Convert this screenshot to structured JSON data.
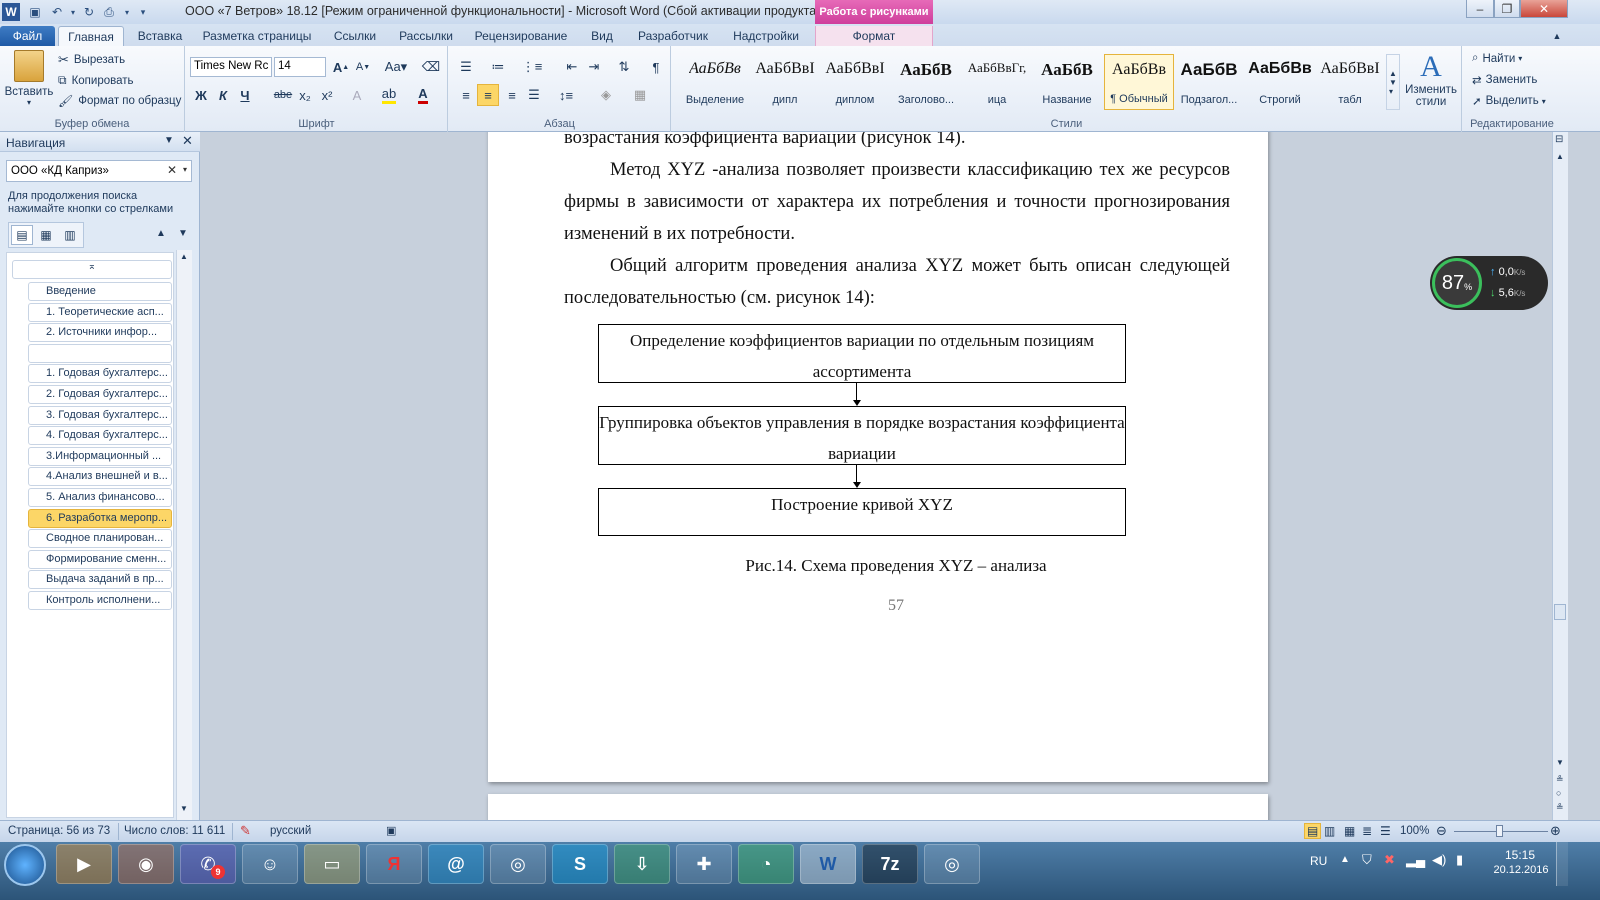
{
  "window": {
    "title": "ООО «7 Ветров»  18.12 [Режим ограниченной функциональности]  -  Microsoft Word (Сбой активации продукта)",
    "context_tab_header": "Работа с рисунками"
  },
  "ribbon_tabs": [
    "Файл",
    "Главная",
    "Вставка",
    "Разметка страницы",
    "Ссылки",
    "Рассылки",
    "Рецензирование",
    "Вид",
    "Разработчик",
    "Надстройки",
    "Формат"
  ],
  "clipboard": {
    "paste": "Вставить",
    "cut": "Вырезать",
    "copy": "Копировать",
    "format_painter": "Формат по образцу",
    "group": "Буфер обмена"
  },
  "font": {
    "name": "Times New Rc",
    "size": "14",
    "bold": "Ж",
    "italic": "К",
    "underline": "Ч",
    "strike": "abe",
    "sub": "x₂",
    "sup": "x²",
    "group": "Шрифт"
  },
  "paragraph": {
    "group": "Абзац"
  },
  "styles": {
    "items": [
      {
        "preview": "АаБбВв",
        "name": "Выделение"
      },
      {
        "preview": "АаБбВвІ",
        "name": "дипл"
      },
      {
        "preview": "АаБбВвІ",
        "name": "диплом"
      },
      {
        "preview": "АаБбВ",
        "name": "Заголово..."
      },
      {
        "preview": "АаБбВвГг,",
        "name": "ица"
      },
      {
        "preview": "АаБбВ",
        "name": "Название"
      },
      {
        "preview": "АаБбВв",
        "name": "¶ Обычный"
      },
      {
        "preview": "АаБбВ",
        "name": "Подзагол..."
      },
      {
        "preview": "АаБбВв",
        "name": "Строгий"
      },
      {
        "preview": "АаБбВвІ",
        "name": "табл"
      }
    ],
    "change_styles": "Изменить стили",
    "group": "Стили"
  },
  "editing": {
    "find": "Найти",
    "replace": "Заменить",
    "select": "Выделить",
    "group": "Редактирование"
  },
  "navigation": {
    "title": "Навигация",
    "search_value": "ООО «КД Каприз»",
    "hint": "Для продолжения поиска нажимайте кнопки со стрелками",
    "items": [
      {
        "label": "Введение",
        "selected": false
      },
      {
        "label": "1. Теоретические асп...",
        "selected": false
      },
      {
        "label": "2. Источники инфор...",
        "selected": false
      },
      {
        "label": "",
        "selected": false
      },
      {
        "label": "1. Годовая бухгалтерс...",
        "selected": false
      },
      {
        "label": "2. Годовая бухгалтерс...",
        "selected": false
      },
      {
        "label": "3. Годовая бухгалтерс...",
        "selected": false
      },
      {
        "label": "4. Годовая бухгалтерс...",
        "selected": false
      },
      {
        "label": "3.Информационный ...",
        "selected": false
      },
      {
        "label": "4.Анализ внешней и в...",
        "selected": false
      },
      {
        "label": "5. Анализ финансово...",
        "selected": false
      },
      {
        "label": "6. Разработка меропр...",
        "selected": true
      },
      {
        "label": "Сводное планирован...",
        "selected": false
      },
      {
        "label": "Формирование сменн...",
        "selected": false
      },
      {
        "label": "Выдача заданий в пр...",
        "selected": false
      },
      {
        "label": "Контроль исполнени...",
        "selected": false
      }
    ]
  },
  "document": {
    "line0": "возрастания коэффициента вариации (рисунок 14).",
    "para1": "Метод XYZ -анализа позволяет произвести классификацию тех же ресурсов фирмы в зависимости от характера их потребления и точности прогнозирования изменений в их потребности.",
    "para2": "Общий алгоритм проведения анализа XYZ может быть описан следующей последовательностью (см. рисунок 14):",
    "box1": "Определение коэффициентов вариации по отдельным позициям ассортимента",
    "box2": "Группировка объектов управления в порядке возрастания коэффициента вариации",
    "box3": "Построение кривой XYZ",
    "caption": "Рис.14. Схема проведения XYZ – анализа",
    "page_number": "57"
  },
  "net_widget": {
    "percent": "87",
    "unit": "%",
    "up": "0,0",
    "down": "5,6",
    "rate_unit": "K/s"
  },
  "statusbar": {
    "page": "Страница: 56 из 73",
    "words": "Число слов: 11 611",
    "lang": "русский",
    "zoom": "100%"
  },
  "taskbar": {
    "lang": "RU",
    "time": "15:15",
    "date": "20.12.2016",
    "badge": "9"
  }
}
